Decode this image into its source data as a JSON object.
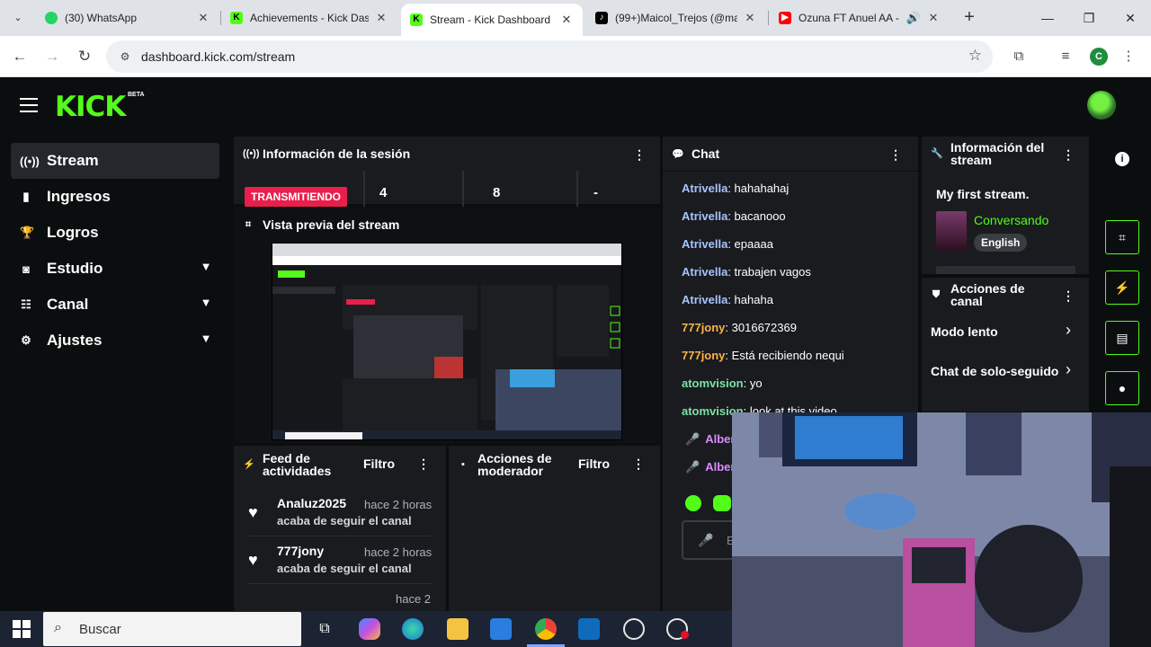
{
  "browser": {
    "tabs": [
      {
        "title": "(30) WhatsApp",
        "favicon": "whatsapp-icon",
        "color": "#25d366"
      },
      {
        "title": "Achievements - Kick Dashboard",
        "favicon": "kick-icon",
        "color": "#53fc18"
      },
      {
        "title": "Stream - Kick Dashboard",
        "favicon": "kick-icon",
        "color": "#53fc18",
        "active": true
      },
      {
        "title": "(99+)Maicol_Trejos (@ma",
        "favicon": "tiktok-icon",
        "color": "#000000"
      },
      {
        "title": "Ozuna FT Anuel AA -",
        "favicon": "youtube-icon",
        "color": "#ff0000"
      }
    ],
    "url": "dashboard.kick.com/stream",
    "profile_initial": "C"
  },
  "kick": {
    "logo": "KICK",
    "beta": "BETA",
    "accent": "#53fc18",
    "sidebar": [
      {
        "label": "Stream",
        "icon": "stream-icon",
        "active": true
      },
      {
        "label": "Ingresos",
        "icon": "income-icon"
      },
      {
        "label": "Logros",
        "icon": "trophy-icon"
      },
      {
        "label": "Estudio",
        "icon": "studio-icon",
        "expand": true
      },
      {
        "label": "Canal",
        "icon": "channel-icon",
        "expand": true
      },
      {
        "label": "Ajustes",
        "icon": "settings-icon",
        "expand": true
      }
    ],
    "session": {
      "title": "Información de la sesión",
      "status": "TRANSMITIENDO",
      "stats": [
        "4",
        "8",
        "-"
      ]
    },
    "preview": {
      "title": "Vista previa del stream"
    },
    "feed": {
      "title": "Feed de actividades",
      "filter": "Filtro",
      "items": [
        {
          "user": "Analuz2025",
          "time": "hace 2 horas",
          "action": "acaba de seguir el canal"
        },
        {
          "user": "777jony",
          "time": "hace 2 horas",
          "action": "acaba de seguir el canal"
        }
      ],
      "partial_time": "hace 2"
    },
    "mod": {
      "title": "Acciones de moderador",
      "filter": "Filtro"
    },
    "chat": {
      "title": "Chat",
      "messages": [
        {
          "user": "Atrivella",
          "text": "hahahahaj",
          "color": "#a7c4ff"
        },
        {
          "user": "Atrivella",
          "text": "bacanooo",
          "color": "#a7c4ff"
        },
        {
          "user": "Atrivella",
          "text": "epaaaa",
          "color": "#a7c4ff"
        },
        {
          "user": "Atrivella",
          "text": "trabajen vagos",
          "color": "#a7c4ff"
        },
        {
          "user": "Atrivella",
          "text": "hahaha",
          "color": "#a7c4ff"
        },
        {
          "user": "777jony",
          "text": "3016672369",
          "color": "#ffb347"
        },
        {
          "user": "777jony",
          "text": "Está recibiendo nequi",
          "color": "#ffb347"
        },
        {
          "user": "atomvision",
          "text": "yo",
          "color": "#7ee0a6"
        },
        {
          "user": "atomvision",
          "text": "look at this video",
          "color": "#7ee0a6"
        },
        {
          "user": "Alber",
          "text": "",
          "color": "#d68cff"
        },
        {
          "user": "Alber",
          "text": "",
          "color": "#d68cff"
        }
      ],
      "input_placeholder": "E"
    },
    "stream_info": {
      "title": "Información del stream",
      "stream_title": "My first stream.",
      "category": "Conversando",
      "language": "English"
    },
    "channel_actions": {
      "title": "Acciones de canal",
      "items": [
        "Modo lento",
        "Chat de solo-seguido"
      ]
    }
  },
  "taskbar": {
    "search": "Buscar"
  }
}
